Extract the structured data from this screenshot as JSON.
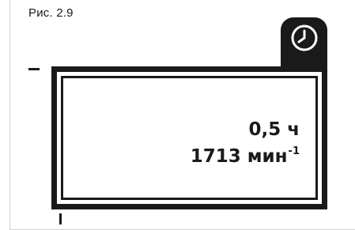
{
  "figure": {
    "label": "Рис. 2.9"
  },
  "display": {
    "time_value": "0,5 ч",
    "speed_value": "1713 мин",
    "speed_exponent": "-1"
  },
  "icons": {
    "tab_icon": "clock-icon"
  },
  "colors": {
    "ink": "#1a1a1a",
    "background": "#ffffff"
  }
}
